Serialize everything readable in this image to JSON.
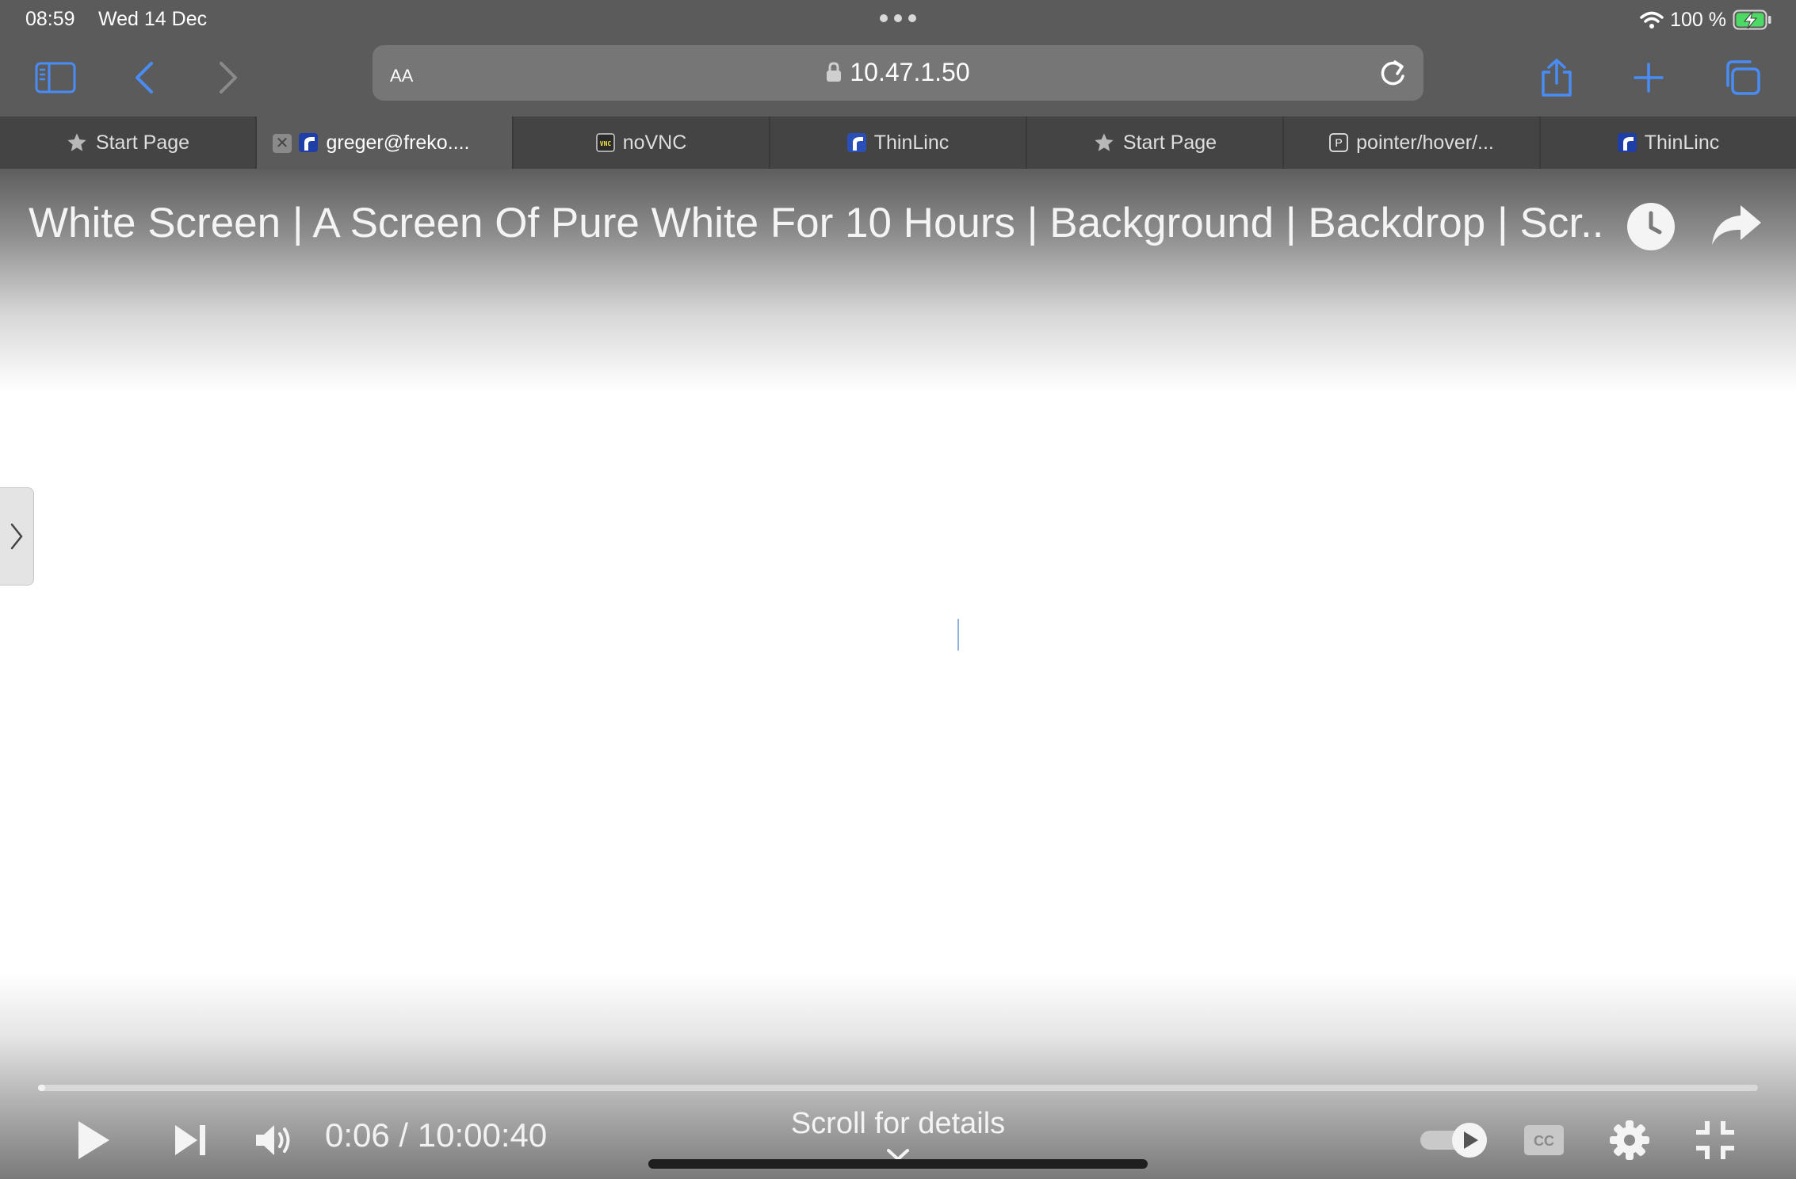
{
  "status": {
    "time": "08:59",
    "date": "Wed 14 Dec",
    "battery": "100 %"
  },
  "toolbar": {
    "url_text_size": "AA",
    "url_host": "10.47.1.50",
    "icons": [
      "sidebar-icon",
      "back-icon",
      "forward-icon",
      "lock-icon",
      "reload-icon",
      "share-icon",
      "new-tab-icon",
      "tabs-overview-icon"
    ],
    "accent_color": "#4a8cf7"
  },
  "tabs": [
    {
      "label": "Start Page"
    },
    {
      "label": "greger@freko...."
    },
    {
      "label": "noVNC"
    },
    {
      "label": "ThinLinc"
    },
    {
      "label": "Start Page"
    },
    {
      "label": "pointer/hover/..."
    },
    {
      "label": "ThinLinc"
    }
  ],
  "player": {
    "title": "White Screen | A Screen Of Pure White For 10 Hours | Background | Backdrop | Scr...",
    "time_display": "0:06 / 10:00:40",
    "scroll_hint": "Scroll for details",
    "progress_fraction": 0.0002,
    "autoplay_on": true
  }
}
